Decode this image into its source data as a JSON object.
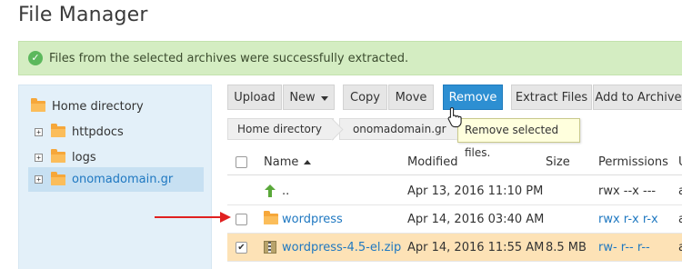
{
  "page": {
    "title": "File Manager"
  },
  "alert": {
    "message": "Files from the selected archives were successfully extracted.",
    "icon": "check-circle-icon",
    "color": "#d4edc2"
  },
  "tree": {
    "items": [
      {
        "label": "Home directory",
        "expander": ""
      },
      {
        "label": "httpdocs",
        "expander": "+"
      },
      {
        "label": "logs",
        "expander": "+"
      },
      {
        "label": "onomadomain.gr",
        "expander": "+",
        "selected": true
      }
    ]
  },
  "toolbar": {
    "upload": "Upload",
    "new": "New",
    "copy": "Copy",
    "move": "Move",
    "remove": "Remove",
    "extract": "Extract Files",
    "add_archive": "Add to Archive"
  },
  "breadcrumb": {
    "items": [
      "Home directory",
      "onomadomain.gr"
    ]
  },
  "tooltip": {
    "text": "Remove selected files."
  },
  "table": {
    "headers": {
      "name": "Name",
      "modified": "Modified",
      "size": "Size",
      "permissions": "Permissions",
      "extra": "U"
    },
    "rows": [
      {
        "name": "..",
        "icon": "up-arrow-icon",
        "modified": "Apr 13, 2016 11:10 PM",
        "size": "",
        "permissions": "rwx --x ---",
        "extra": "a",
        "checkbox": false,
        "checked": false,
        "selected": false
      },
      {
        "name": "wordpress",
        "icon": "folder-icon",
        "modified": "Apr 14, 2016 03:40 AM",
        "size": "",
        "permissions": "rwx r-x r-x",
        "extra": "a",
        "checkbox": true,
        "checked": false,
        "selected": false
      },
      {
        "name": "wordpress-4.5-el.zip",
        "icon": "zip-icon",
        "modified": "Apr 14, 2016 11:55 AM",
        "size": "8.5 MB",
        "permissions": "rw- r-- r--",
        "extra": "a",
        "checkbox": true,
        "checked": true,
        "selected": true
      }
    ]
  },
  "colors": {
    "accent": "#2d8fd2",
    "tree_bg": "#e3f0f9",
    "selected_row": "#fde2b6",
    "arrow": "#e02020"
  }
}
